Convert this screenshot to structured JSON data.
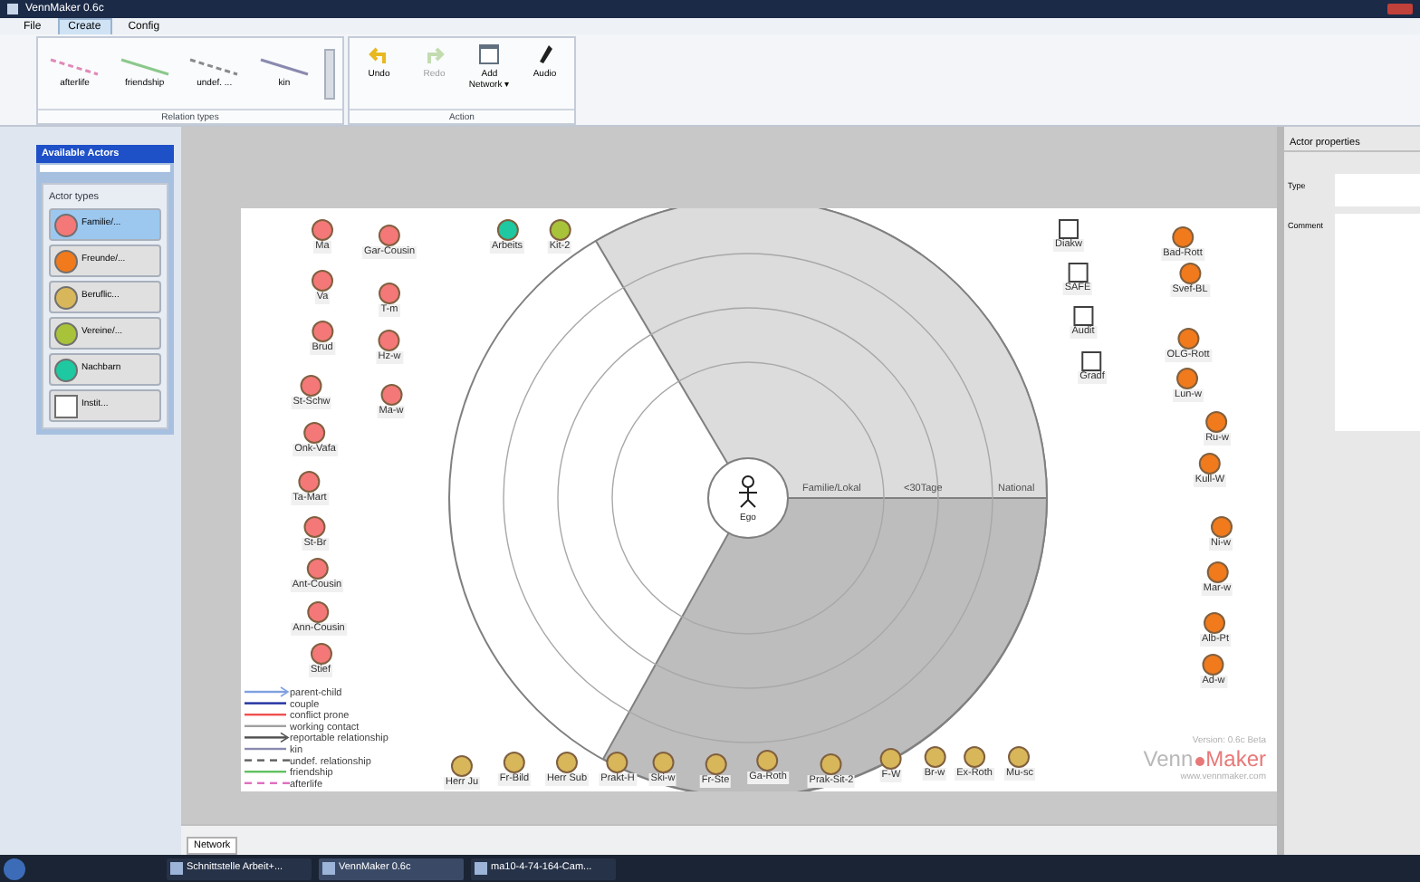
{
  "window": {
    "title": "VennMaker 0.6c"
  },
  "menu": [
    {
      "label": "File",
      "selected": false
    },
    {
      "label": "Create",
      "selected": true
    },
    {
      "label": "Config",
      "selected": false
    }
  ],
  "ribbon": {
    "relation_types": {
      "caption": "Relation types",
      "items": [
        {
          "label": "afterlife",
          "color": "#e08ab8",
          "kind": "dashed"
        },
        {
          "label": "friendship",
          "color": "#8cc88c",
          "kind": "solid"
        },
        {
          "label": "undef. ...",
          "color": "#8a8a8a",
          "kind": "dashed"
        },
        {
          "label": "kin",
          "color": "#8a8ab0",
          "kind": "solid"
        }
      ]
    },
    "action": {
      "caption": "Action",
      "buttons": [
        {
          "label": "Undo",
          "kind": "undo",
          "disabled": false
        },
        {
          "label": "Redo",
          "kind": "redo",
          "disabled": true
        },
        {
          "label": "Add Network ▾",
          "kind": "network",
          "disabled": false
        },
        {
          "label": "Audio",
          "kind": "audio",
          "disabled": false
        }
      ]
    }
  },
  "sidebar": {
    "title": "Available Actors",
    "section": "Actor types",
    "actor_types": [
      {
        "label": "Familie/...",
        "kind": "circle",
        "color": "#f47878",
        "selected": true
      },
      {
        "label": "Freunde/...",
        "kind": "circle",
        "color": "#f07a1c",
        "selected": false
      },
      {
        "label": "Berufliс...",
        "kind": "circle",
        "color": "#d8b65a",
        "selected": false
      },
      {
        "label": "Vereine/...",
        "kind": "circle",
        "color": "#a8c23a",
        "selected": false
      },
      {
        "label": "Nachbarn",
        "kind": "circle",
        "color": "#1ec8a0",
        "selected": false
      },
      {
        "label": "Instit...",
        "kind": "square",
        "color": "#ffffff",
        "selected": false
      }
    ]
  },
  "network": {
    "ego": "Ego",
    "sector_labels": [
      "Familie/Lokal",
      "<30Tage",
      "National"
    ],
    "actors": [
      {
        "label": "Ma",
        "kind": "circle",
        "color": "#f47878"
      },
      {
        "label": "Gar-Cousin",
        "kind": "circle",
        "color": "#f47878"
      },
      {
        "label": "Va",
        "kind": "circle",
        "color": "#f47878"
      },
      {
        "label": "T-m",
        "kind": "circle",
        "color": "#f47878"
      },
      {
        "label": "Brud",
        "kind": "circle",
        "color": "#f47878"
      },
      {
        "label": "Hz-w",
        "kind": "circle",
        "color": "#f47878"
      },
      {
        "label": "St-Schw",
        "kind": "circle",
        "color": "#f47878"
      },
      {
        "label": "Ma-w",
        "kind": "circle",
        "color": "#f47878"
      },
      {
        "label": "Onk-Vafa",
        "kind": "circle",
        "color": "#f47878"
      },
      {
        "label": "Ta-Mart",
        "kind": "circle",
        "color": "#f47878"
      },
      {
        "label": "St-Br",
        "kind": "circle",
        "color": "#f47878"
      },
      {
        "label": "Ant-Cousin",
        "kind": "circle",
        "color": "#f47878"
      },
      {
        "label": "Ann-Cousin",
        "kind": "circle",
        "color": "#f47878"
      },
      {
        "label": "Stief",
        "kind": "circle",
        "color": "#f47878"
      },
      {
        "label": "Arbeits",
        "kind": "circle",
        "color": "#1ec8a0"
      },
      {
        "label": "Kit-2",
        "kind": "circle",
        "color": "#a8c23a"
      },
      {
        "label": "Diakw",
        "kind": "square",
        "color": "#ffffff"
      },
      {
        "label": "SAFE",
        "kind": "square",
        "color": "#ffffff"
      },
      {
        "label": "Audit",
        "kind": "square",
        "color": "#ffffff"
      },
      {
        "label": "Gradf",
        "kind": "square",
        "color": "#ffffff"
      },
      {
        "label": "Bad-Rott",
        "kind": "circle",
        "color": "#f07a1c"
      },
      {
        "label": "Svef-BL",
        "kind": "circle",
        "color": "#f07a1c"
      },
      {
        "label": "OLG-Rott",
        "kind": "circle",
        "color": "#f07a1c"
      },
      {
        "label": "Lun-w",
        "kind": "circle",
        "color": "#f07a1c"
      },
      {
        "label": "Ru-w",
        "kind": "circle",
        "color": "#f07a1c"
      },
      {
        "label": "Kull-W",
        "kind": "circle",
        "color": "#f07a1c"
      },
      {
        "label": "Ni-w",
        "kind": "circle",
        "color": "#f07a1c"
      },
      {
        "label": "Mar-w",
        "kind": "circle",
        "color": "#f07a1c"
      },
      {
        "label": "Alb-Pt",
        "kind": "circle",
        "color": "#f07a1c"
      },
      {
        "label": "Ad-w",
        "kind": "circle",
        "color": "#f07a1c"
      },
      {
        "label": "Herr Ju",
        "kind": "circle",
        "color": "#d8b65a"
      },
      {
        "label": "Fr-Bild",
        "kind": "circle",
        "color": "#d8b65a"
      },
      {
        "label": "Herr Sub",
        "kind": "circle",
        "color": "#d8b65a"
      },
      {
        "label": "Prakt-H",
        "kind": "circle",
        "color": "#d8b65a"
      },
      {
        "label": "Ski-w",
        "kind": "circle",
        "color": "#d8b65a"
      },
      {
        "label": "Fr-Ste",
        "kind": "circle",
        "color": "#d8b65a"
      },
      {
        "label": "Ga-Roth",
        "kind": "circle",
        "color": "#d8b65a"
      },
      {
        "label": "Prak-Sit-2",
        "kind": "circle",
        "color": "#d8b65a"
      },
      {
        "label": "F-W",
        "kind": "circle",
        "color": "#d8b65a"
      },
      {
        "label": "Br-w",
        "kind": "circle",
        "color": "#d8b65a"
      },
      {
        "label": "Ex-Roth",
        "kind": "circle",
        "color": "#d8b65a"
      },
      {
        "label": "Mu-sc",
        "kind": "circle",
        "color": "#d8b65a"
      }
    ],
    "legend": [
      {
        "label": "parent-child",
        "color": "#7fa0e0",
        "kind": "arrow"
      },
      {
        "label": "couple",
        "color": "#2030a0",
        "kind": "solid"
      },
      {
        "label": "conflict prone",
        "color": "#f05050",
        "kind": "solid"
      },
      {
        "label": "working contact",
        "color": "#a0a0a0",
        "kind": "solid"
      },
      {
        "label": "reportable relationship",
        "color": "#505050",
        "kind": "arrow"
      },
      {
        "label": "kin",
        "color": "#8a8ab0",
        "kind": "solid"
      },
      {
        "label": "undef. relationship",
        "color": "#606060",
        "kind": "dashed"
      },
      {
        "label": "friendship",
        "color": "#60c060",
        "kind": "solid"
      },
      {
        "label": "afterlife",
        "color": "#e070c0",
        "kind": "dashed"
      }
    ],
    "version": "Version: 0.6c Beta",
    "logo": [
      "Venn",
      "Maker"
    ],
    "url": "www.vennmaker.com"
  },
  "tabs": [
    {
      "label": "Network",
      "selected": true
    }
  ],
  "properties": {
    "title": "Actor properties",
    "fields": [
      "Type",
      "Comment"
    ]
  },
  "taskbar": [
    {
      "label": "Schnittstelle Arbeit+...",
      "selected": false
    },
    {
      "label": "VennMaker 0.6c",
      "selected": true
    },
    {
      "label": "ma10-4-74-164-Cam...",
      "selected": false
    }
  ]
}
